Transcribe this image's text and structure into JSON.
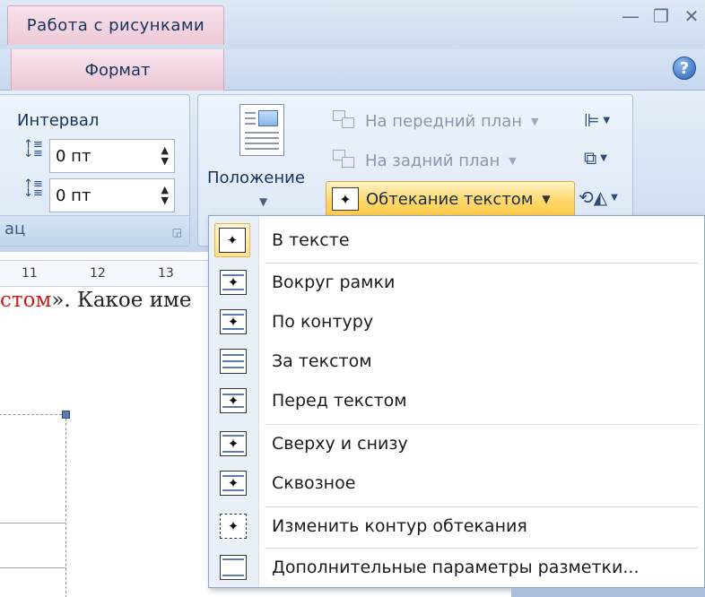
{
  "titlebar": {
    "context_tab": "Работа с рисунками",
    "minimize": "—",
    "maximize": "❐",
    "close": "✕"
  },
  "tabs": {
    "format": "Формат",
    "help": "?"
  },
  "paragraph_group": {
    "interval_label": "Интервал",
    "before_value": "0 пт",
    "after_value": "0 пт",
    "footer_label": "ац"
  },
  "arrange_group": {
    "position_label": "Положение",
    "bring_forward": "На передний план",
    "send_backward": "На задний план",
    "text_wrapping": "Обтекание текстом"
  },
  "ruler": {
    "ticks": [
      "11",
      "12",
      "13"
    ]
  },
  "document": {
    "text_red": "стом",
    "text_rest": "». Какое име"
  },
  "wrap_menu": {
    "items": [
      {
        "label": "В тексте"
      },
      {
        "label": "Вокруг рамки"
      },
      {
        "label": "По контуру"
      },
      {
        "label": "За текстом"
      },
      {
        "label": "Перед текстом"
      },
      {
        "label": "Сверху и снизу"
      },
      {
        "label": "Сквозное"
      },
      {
        "label": "Изменить контур обтекания"
      },
      {
        "label": "Дополнительные параметры разметки..."
      }
    ]
  },
  "colors": {
    "context_tab": "#eec9d7",
    "highlight": "#ffd86b",
    "annotation_arrow": "#e02020"
  }
}
